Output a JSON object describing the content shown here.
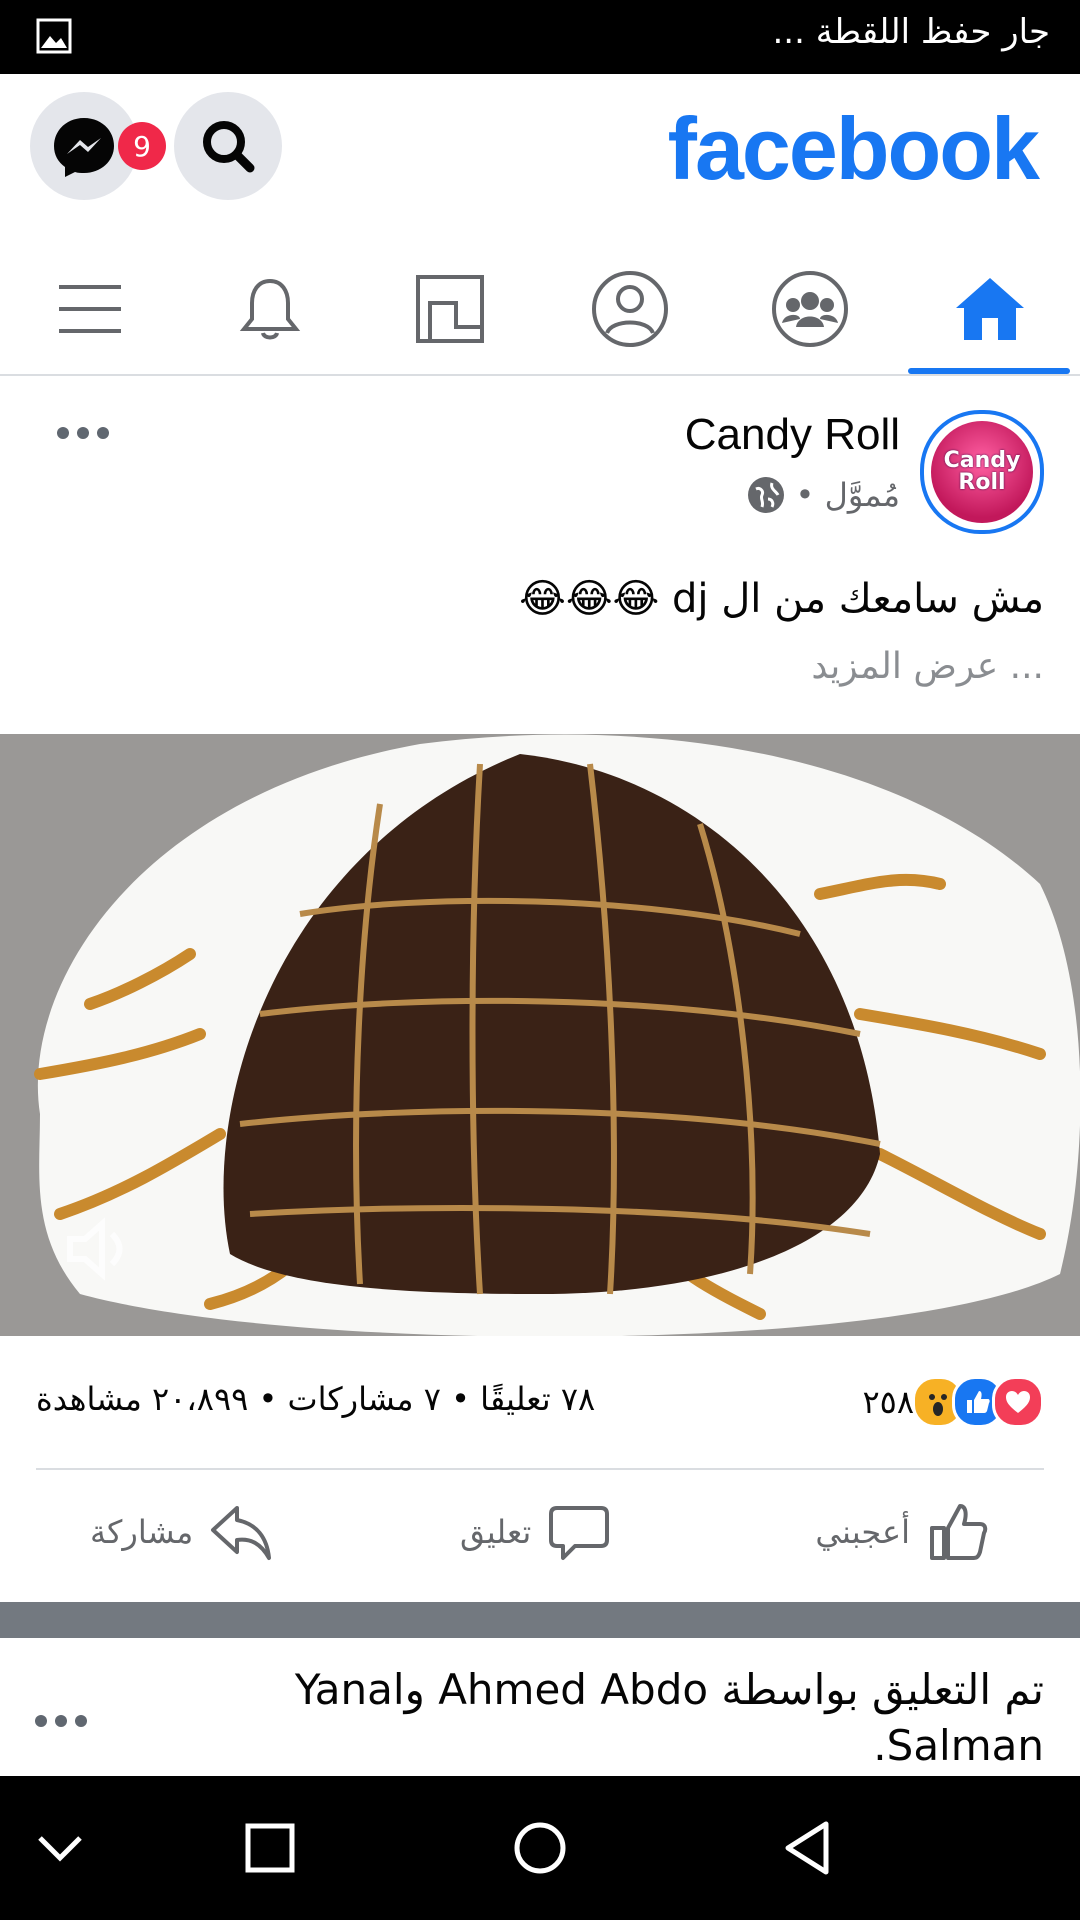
{
  "status_bar": {
    "text": "جار حفظ اللقطة ...",
    "left_icon": "image-icon"
  },
  "header": {
    "logo": "facebook",
    "messenger_badge": "9",
    "icons": [
      "messenger-icon",
      "search-icon"
    ]
  },
  "tabs": [
    {
      "name": "menu",
      "icon": "menu-icon"
    },
    {
      "name": "notifications",
      "icon": "bell-icon"
    },
    {
      "name": "marketplace",
      "icon": "marketplace-icon"
    },
    {
      "name": "profile",
      "icon": "profile-icon"
    },
    {
      "name": "groups",
      "icon": "groups-icon"
    },
    {
      "name": "home",
      "icon": "home-icon",
      "active": true
    }
  ],
  "post": {
    "page_name": "Candy Roll",
    "avatar_text": "Candy Roll",
    "sponsored": "مُموَّل •",
    "caption": "مش سامعك من ال dj 😂😂😂",
    "see_more": "... عرض المزيد",
    "reactions": [
      "like",
      "love",
      "wow"
    ],
    "reaction_count": "٢٥٨",
    "stats": "٧٨ تعليقًا • ٧ مشاركات • ٢٠،٨٩٩ مشاهدة",
    "actions": {
      "like": "أعجبني",
      "comment": "تعليق",
      "share": "مشاركة"
    }
  },
  "next_post": {
    "text": "تم التعليق بواسطة Ahmed Abdo وYanal Salman."
  },
  "colors": {
    "brand": "#1877f2",
    "badge": "#f02849",
    "secondary_text": "#65676b",
    "separator": "#737980"
  }
}
